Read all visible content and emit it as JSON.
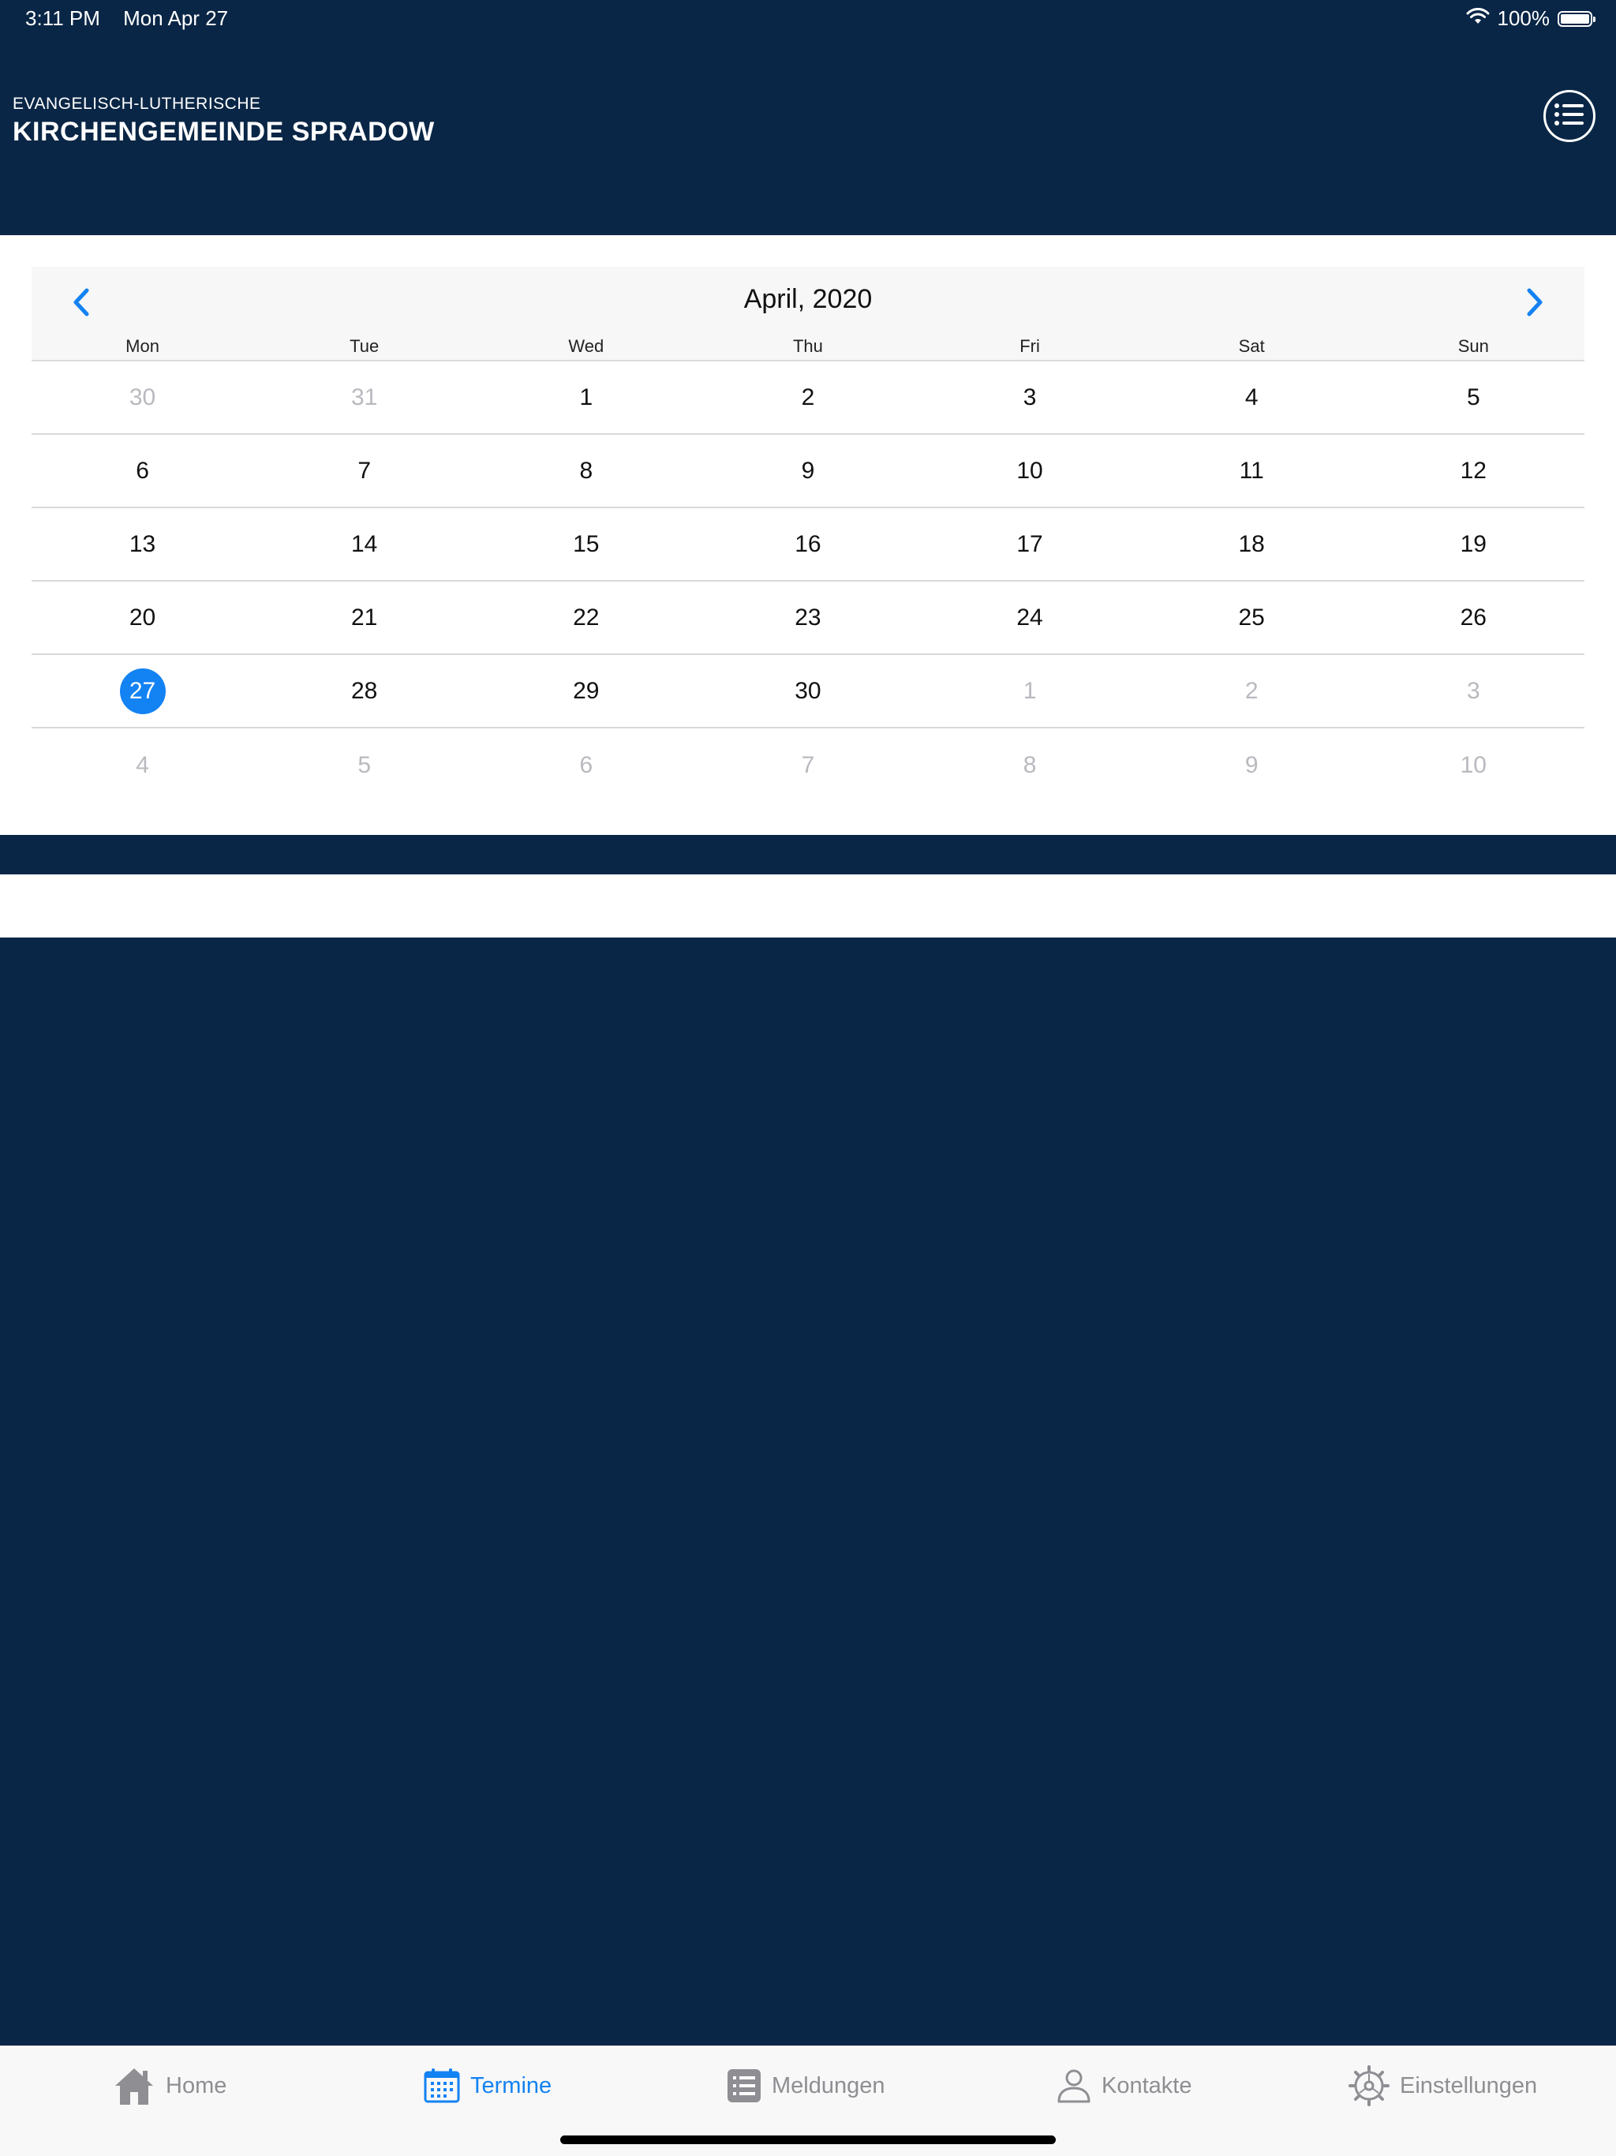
{
  "status_bar": {
    "time": "3:11 PM",
    "date": "Mon Apr 27",
    "battery": "100%"
  },
  "header": {
    "subtitle": "EVANGELISCH-LUTHERISCHE",
    "title": "KIRCHENGEMEINDE SPRADOW",
    "menu_icon": "list-icon"
  },
  "calendar": {
    "month_title": "April, 2020",
    "weekdays": [
      "Mon",
      "Tue",
      "Wed",
      "Thu",
      "Fri",
      "Sat",
      "Sun"
    ],
    "selected_day": "27",
    "accent_color": "#1382f2",
    "weeks": [
      [
        "30",
        "31",
        "1",
        "2",
        "3",
        "4",
        "5"
      ],
      [
        "6",
        "7",
        "8",
        "9",
        "10",
        "11",
        "12"
      ],
      [
        "13",
        "14",
        "15",
        "16",
        "17",
        "18",
        "19"
      ],
      [
        "20",
        "21",
        "22",
        "23",
        "24",
        "25",
        "26"
      ],
      [
        "27",
        "28",
        "29",
        "30",
        "1",
        "2",
        "3"
      ],
      [
        "4",
        "5",
        "6",
        "7",
        "8",
        "9",
        "10"
      ]
    ]
  },
  "tabs": [
    {
      "label": "Home",
      "icon": "home-icon"
    },
    {
      "label": "Termine",
      "icon": "calendar-icon"
    },
    {
      "label": "Meldungen",
      "icon": "news-list-icon"
    },
    {
      "label": "Kontakte",
      "icon": "person-icon"
    },
    {
      "label": "Einstellungen",
      "icon": "gear-icon"
    }
  ],
  "colors": {
    "background": "#0a2646",
    "tab_active": "#1382f2",
    "tab_inactive": "#8e8e93"
  }
}
